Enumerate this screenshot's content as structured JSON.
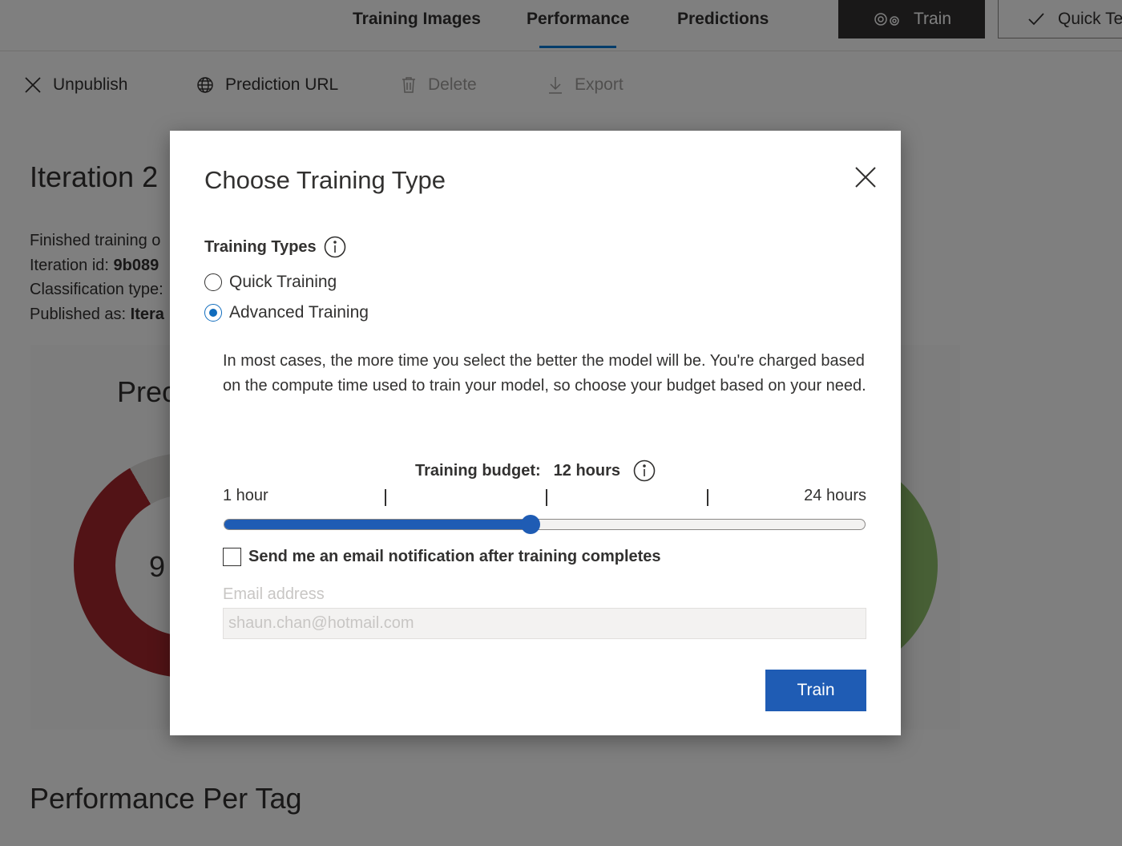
{
  "nav": {
    "tabs": [
      {
        "label": "Training Images"
      },
      {
        "label": "Performance"
      },
      {
        "label": "Predictions"
      }
    ],
    "train_label": "Train",
    "quick_test_label": "Quick Te"
  },
  "commands": {
    "unpublish": "Unpublish",
    "prediction_url": "Prediction URL",
    "delete": "Delete",
    "export": "Export"
  },
  "iteration": {
    "title": "Iteration 2",
    "finished_training": "Finished training o",
    "id_label": "Iteration id: ",
    "id_value": "9b089",
    "classification_type": "Classification type:",
    "published_label": "Published as: ",
    "published_value": "Itera",
    "precision_label": "Prec",
    "precision_value": "9"
  },
  "performance_per_tag": "Performance Per Tag",
  "modal": {
    "title": "Choose Training Type",
    "training_types_label": "Training Types",
    "options": [
      {
        "label": "Quick Training",
        "checked": false
      },
      {
        "label": "Advanced Training",
        "checked": true
      }
    ],
    "description": "In most cases, the more time you select the better the model will be. You're charged based on the compute time used to train your model, so choose your budget based on your need.",
    "budget_label": "Training budget:",
    "budget_value": "12 hours",
    "slider": {
      "min_label": "1 hour",
      "max_label": "24 hours",
      "min": 1,
      "max": 24,
      "value": 12
    },
    "email_checkbox_label": "Send me an email notification after training completes",
    "email_checked": false,
    "email_label": "Email address",
    "email_placeholder": "shaun.chan@hotmail.com",
    "train_button": "Train"
  },
  "colors": {
    "accent": "#1f5cb4",
    "overlay": "rgba(0,0,0,0.5)"
  }
}
